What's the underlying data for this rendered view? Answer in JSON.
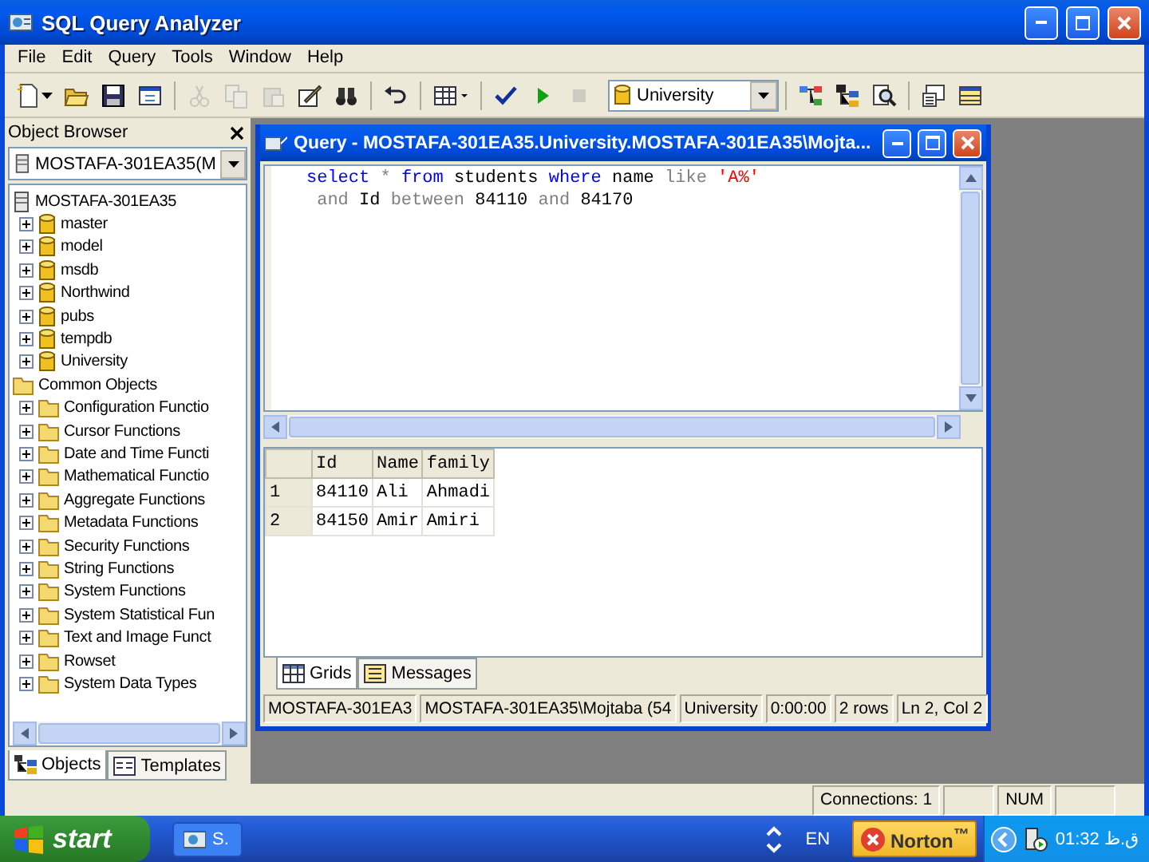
{
  "window": {
    "title": "SQL Query Analyzer"
  },
  "menu": [
    "File",
    "Edit",
    "Query",
    "Tools",
    "Window",
    "Help"
  ],
  "toolbar": [
    {
      "kind": "new",
      "disabled": false
    },
    {
      "kind": "open",
      "disabled": false
    },
    {
      "kind": "save",
      "disabled": false
    },
    {
      "kind": "load",
      "disabled": false
    },
    {
      "kind": "separator"
    },
    {
      "kind": "cut",
      "disabled": true
    },
    {
      "kind": "copy",
      "disabled": true
    },
    {
      "kind": "paste",
      "disabled": true
    },
    {
      "kind": "template",
      "disabled": false
    },
    {
      "kind": "find",
      "disabled": false
    },
    {
      "kind": "separator"
    },
    {
      "kind": "undo",
      "disabled": false
    },
    {
      "kind": "separator"
    },
    {
      "kind": "grid",
      "disabled": false
    },
    {
      "kind": "separator"
    },
    {
      "kind": "check",
      "disabled": false
    },
    {
      "kind": "run",
      "disabled": false
    },
    {
      "kind": "stop",
      "disabled": true
    },
    {
      "kind": "database",
      "value": "University"
    },
    {
      "kind": "separator"
    },
    {
      "kind": "plan",
      "disabled": false
    },
    {
      "kind": "tree",
      "disabled": false
    },
    {
      "kind": "search",
      "disabled": false
    },
    {
      "kind": "separator"
    },
    {
      "kind": "properties",
      "disabled": false
    },
    {
      "kind": "pane",
      "disabled": false
    }
  ],
  "object_browser": {
    "title": "Object Browser",
    "server": "MOSTAFA-301EA35(M",
    "tree": [
      {
        "label": "MOSTAFA-301EA35",
        "kind": "server",
        "children": [
          {
            "label": "master",
            "kind": "database",
            "expanded": false
          },
          {
            "label": "model",
            "kind": "database",
            "expanded": false
          },
          {
            "label": "msdb",
            "kind": "database",
            "expanded": false
          },
          {
            "label": "Northwind",
            "kind": "database",
            "expanded": false
          },
          {
            "label": "pubs",
            "kind": "database",
            "expanded": false
          },
          {
            "label": "tempdb",
            "kind": "database",
            "expanded": false
          },
          {
            "label": "University",
            "kind": "database",
            "expanded": false
          }
        ]
      },
      {
        "label": "Common Objects",
        "kind": "folder",
        "children": [
          {
            "label": "Configuration Functio",
            "kind": "folder",
            "expanded": false
          },
          {
            "label": "Cursor Functions",
            "kind": "folder",
            "expanded": false
          },
          {
            "label": "Date and Time Functi",
            "kind": "folder",
            "expanded": false
          },
          {
            "label": "Mathematical Functio",
            "kind": "folder",
            "expanded": false
          },
          {
            "label": "Aggregate Functions",
            "kind": "folder",
            "expanded": false
          },
          {
            "label": "Metadata Functions",
            "kind": "folder",
            "expanded": false
          },
          {
            "label": "Security Functions",
            "kind": "folder",
            "expanded": false
          },
          {
            "label": "String Functions",
            "kind": "folder",
            "expanded": false
          },
          {
            "label": "System Functions",
            "kind": "folder",
            "expanded": false
          },
          {
            "label": "System Statistical Fun",
            "kind": "folder",
            "expanded": false
          },
          {
            "label": "Text and Image Funct",
            "kind": "folder",
            "expanded": false
          },
          {
            "label": "Rowset",
            "kind": "folder",
            "expanded": false
          },
          {
            "label": "System Data Types",
            "kind": "folder",
            "expanded": false
          }
        ]
      }
    ],
    "tabs": [
      {
        "label": "Objects",
        "selected": true
      },
      {
        "label": "Templates",
        "selected": false
      }
    ]
  },
  "query_window": {
    "title": "Query - MOSTAFA-301EA35.University.MOSTAFA-301EA35\\Mojta...",
    "editor": [
      [
        {
          "kind": "keyword",
          "text": "select"
        },
        {
          "kind": "operator",
          "text": "*"
        },
        {
          "kind": "keyword",
          "text": "from"
        },
        {
          "kind": "ident",
          "text": "students"
        },
        {
          "kind": "keyword",
          "text": "where"
        },
        {
          "kind": "ident",
          "text": "name"
        },
        {
          "kind": "operator",
          "text": "like"
        },
        {
          "kind": "string",
          "text": "'A%'"
        }
      ],
      [
        {
          "kind": "operator",
          "text": " and"
        },
        {
          "kind": "ident",
          "text": "Id"
        },
        {
          "kind": "operator",
          "text": "between"
        },
        {
          "kind": "ident",
          "text": "84110"
        },
        {
          "kind": "operator",
          "text": "and"
        },
        {
          "kind": "ident",
          "text": "84170"
        }
      ]
    ],
    "results": {
      "columns": [
        "Id",
        "Name",
        "family"
      ],
      "rows": [
        {
          "number": "1",
          "cells": [
            "84110",
            "Ali",
            "Ahmadi"
          ]
        },
        {
          "number": "2",
          "cells": [
            "84150",
            "Amir",
            "Amiri"
          ]
        }
      ]
    },
    "result_tabs": [
      {
        "label": "Grids",
        "kind": "grid",
        "selected": true
      },
      {
        "label": "Messages",
        "kind": "messages",
        "selected": false
      }
    ],
    "status": [
      "MOSTAFA-301EA3",
      "MOSTAFA-301EA35\\Mojtaba (54",
      "University",
      "0:00:00",
      "2 rows",
      "Ln 2, Col 2"
    ]
  },
  "status_bar": [
    "Connections: 1",
    "NUM"
  ],
  "taskbar": {
    "start": "start",
    "tasks": [
      {
        "label": "S.",
        "selected": false
      }
    ],
    "language": "EN",
    "norton": "Norton$^{™}$",
    "clock": "01:32 ق.ظ"
  }
}
